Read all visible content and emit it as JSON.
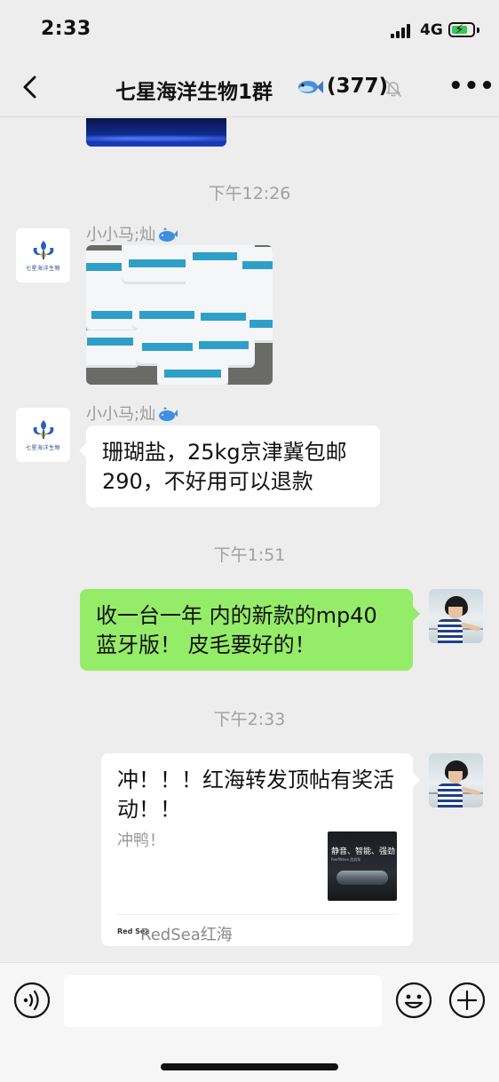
{
  "status": {
    "time": "2:33",
    "network": "4G",
    "battery_level": 0.75,
    "battery_color": "#35c759"
  },
  "nav": {
    "back_icon": "chevron-left-icon",
    "title": "七星海洋生物1群",
    "title_icon": "fish-icon",
    "member_count": "(377)",
    "mute_icon": "bell-slash-icon",
    "more_icon": "ellipsis-icon"
  },
  "group_avatar": {
    "label": "七星海洋生物"
  },
  "messages": [
    {
      "type": "timestamp",
      "text": "下午12:26"
    },
    {
      "type": "image",
      "side": "left",
      "sender": "小小马;灿",
      "sender_icon": "whale-icon"
    },
    {
      "type": "text",
      "side": "left",
      "sender": "小小马;灿",
      "sender_icon": "whale-icon",
      "text_line1": "珊瑚盐，25kg京津冀包邮",
      "text_line2": "290，不好用可以退款"
    },
    {
      "type": "timestamp",
      "text": "下午1:51"
    },
    {
      "type": "text",
      "side": "right",
      "text_line1": "收一台一年 内的新款的mp40",
      "text_line2": "蓝牙版！ 皮毛要好的！"
    },
    {
      "type": "timestamp",
      "text": "下午2:33"
    },
    {
      "type": "link_card",
      "side": "right",
      "title": "冲！！！红海转发顶帖有奖活动！！",
      "description": "冲鸭！",
      "thumb_text": "静音、智能、强劲",
      "thumb_subtext": "ReefWave 造浪泵",
      "source_logo": "Red Sea",
      "source": "RedSea红海"
    }
  ],
  "colors": {
    "background": "#ededed",
    "outgoing_bubble": "#95ec69",
    "incoming_bubble": "#ffffff",
    "timestamp": "#a0a0a0"
  },
  "input_bar": {
    "voice_icon": "voice-icon",
    "emoji_icon": "emoji-icon",
    "plus_icon": "plus-circle-icon",
    "placeholder": ""
  }
}
